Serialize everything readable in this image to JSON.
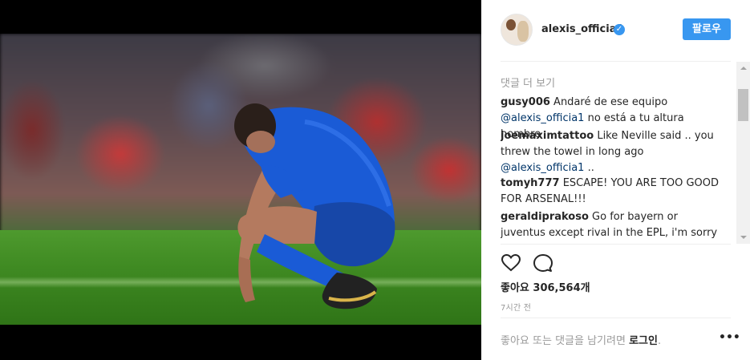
{
  "post": {
    "username": "alexis_officia1",
    "follow_label": "팔로우",
    "load_more_label": "댓글 더 보기",
    "comments": [
      {
        "author": "gusy006",
        "text1": " Andaré de ese equipo ",
        "mention": "@alexis_officia1",
        "text2": " no está a tu altura hombre"
      },
      {
        "author": "joemaximtattoo",
        "text1": " Like Neville said .. you threw the towel in long ago ",
        "mention": "@alexis_officia1",
        "text2": " .."
      },
      {
        "author": "tomyh777",
        "text1": " ESCAPE! YOU ARE TOO GOOD FOR ARSENAL!!!"
      },
      {
        "author": "geraldiprakoso",
        "text1": " Go for bayern or juventus except rival in the EPL, i'm sorry for you. You are totally frustrated about this club"
      }
    ],
    "likes_label": "좋아요",
    "likes_count": "306,564개",
    "timestamp": "7시간 전",
    "login_prompt": "좋아요 또는 댓글을 남기려면",
    "login_link": "로그인",
    "login_suffix": "."
  },
  "icons": [
    "verified-badge-icon",
    "heart-icon",
    "comment-icon",
    "more-options-icon"
  ],
  "colors": {
    "accent": "#3897f0",
    "mention": "#003569",
    "muted": "#999999"
  }
}
